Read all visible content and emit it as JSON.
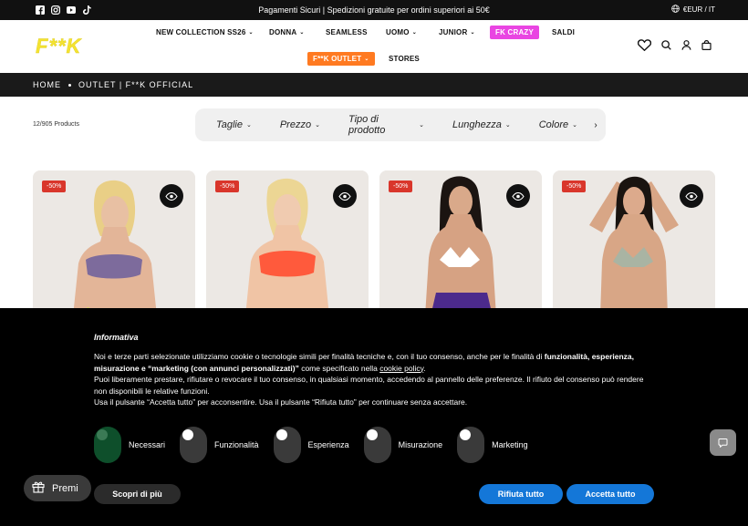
{
  "topbar": {
    "promo": "Pagamenti Sicuri | Spedizioni gratuite per ordini superiori ai 50€",
    "locale": "€EUR / IT",
    "social_icons": [
      "facebook-icon",
      "instagram-icon",
      "youtube-icon",
      "tiktok-icon"
    ]
  },
  "header": {
    "logo": "F**K",
    "nav": [
      {
        "label": "NEW COLLECTION SS26",
        "dropdown": true
      },
      {
        "label": "DONNA",
        "dropdown": true
      },
      {
        "label": "SEAMLESS",
        "dropdown": false
      },
      {
        "label": "UOMO",
        "dropdown": true
      },
      {
        "label": "JUNIOR",
        "dropdown": true
      },
      {
        "label": "FK CRAZY",
        "dropdown": false
      },
      {
        "label": "SALDI",
        "dropdown": false
      },
      {
        "label": "F**K OUTLET",
        "dropdown": true
      },
      {
        "label": "STORES",
        "dropdown": false
      }
    ],
    "icons": [
      "wishlist-icon",
      "search-icon",
      "account-icon",
      "cart-icon"
    ]
  },
  "breadcrumb": {
    "home": "HOME",
    "current": "OUTLET | F**K OFFICIAL"
  },
  "listing": {
    "count": "12/905 Products",
    "filters": [
      "Taglie",
      "Prezzo",
      "Tipo di prodotto",
      "Lunghezza",
      "Colore"
    ]
  },
  "products": [
    {
      "badge": "-50%",
      "color": "#7d6b9c"
    },
    {
      "badge": "-50%",
      "color": "#ff5a3c"
    },
    {
      "badge": "-50%",
      "color": "#ffffff"
    },
    {
      "badge": "-50%",
      "color": "#a9b4a3"
    }
  ],
  "cookie": {
    "title": "Informativa",
    "p1_a": "Noi e terze parti selezionate utilizziamo cookie o tecnologie simili per finalità tecniche e, con il tuo consenso, anche per le finalità di ",
    "p1_b": "funzionalità, esperienza, misurazione e “marketing (con annunci personalizzati)”",
    "p1_c": " come specificato nella ",
    "p1_link": "cookie policy",
    "p1_d": ".",
    "p2": "Puoi liberamente prestare, rifiutare o revocare il tuo consenso, in qualsiasi momento, accedendo al pannello delle preferenze. Il rifiuto del consenso può rendere non disponibili le relative funzioni.",
    "p3": "Usa il pulsante “Accetta tutto” per acconsentire. Usa il pulsante “Rifiuta tutto” per continuare senza accettare.",
    "toggles": [
      {
        "label": "Necessari",
        "on": true
      },
      {
        "label": "Funzionalità",
        "on": false
      },
      {
        "label": "Esperienza",
        "on": false
      },
      {
        "label": "Misurazione",
        "on": false
      },
      {
        "label": "Marketing",
        "on": false
      }
    ],
    "btn_more": "Scopri di più",
    "btn_reject": "Rifiuta tutto",
    "btn_accept": "Accetta tutto"
  },
  "rewards": {
    "label": "Premi"
  },
  "colors": {
    "accent_blue": "#1477d8",
    "logo_yellow": "#f4e332",
    "badge_red": "#d9362b",
    "pink_pill": "#e945e2",
    "orange_pill": "#ff7a21"
  }
}
